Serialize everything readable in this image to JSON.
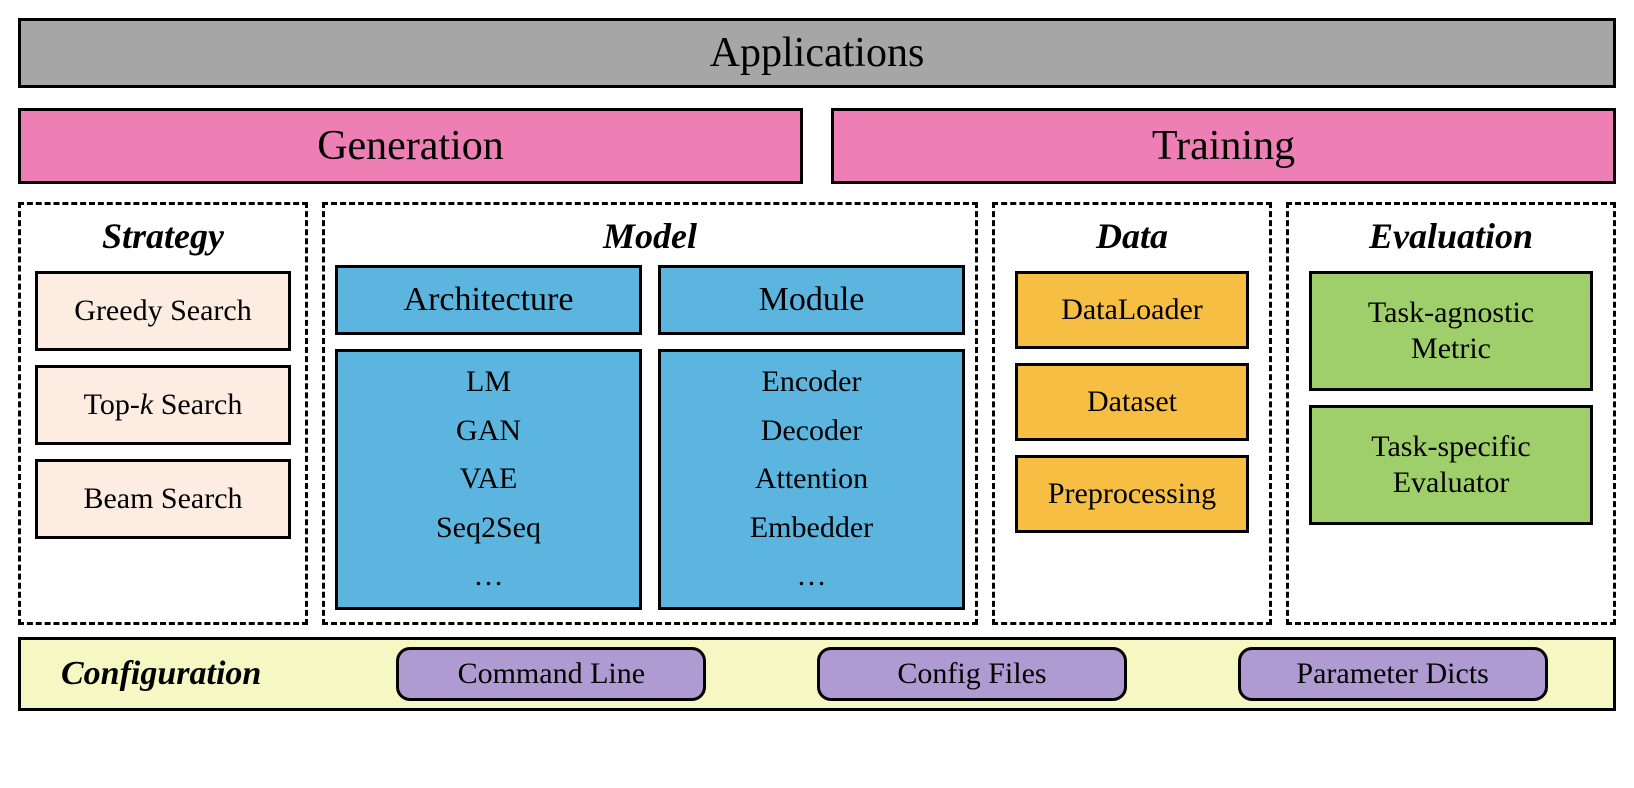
{
  "top": {
    "applications": "Applications"
  },
  "headers": {
    "generation": "Generation",
    "training": "Training"
  },
  "groups": {
    "strategy": {
      "title": "Strategy",
      "items": [
        "Greedy Search",
        "Top-k Search",
        "Beam Search"
      ]
    },
    "model": {
      "title": "Model",
      "architecture": {
        "title": "Architecture",
        "items": [
          "LM",
          "GAN",
          "VAE",
          "Seq2Seq",
          "…"
        ]
      },
      "module": {
        "title": "Module",
        "items": [
          "Encoder",
          "Decoder",
          "Attention",
          "Embedder",
          "…"
        ]
      }
    },
    "data": {
      "title": "Data",
      "items": [
        "DataLoader",
        "Dataset",
        "Preprocessing"
      ]
    },
    "evaluation": {
      "title": "Evaluation",
      "items": [
        {
          "line1": "Task-agnostic",
          "line2": "Metric"
        },
        {
          "line1": "Task-specific",
          "line2": "Evaluator"
        }
      ]
    }
  },
  "config": {
    "title": "Configuration",
    "items": [
      "Command Line",
      "Config Files",
      "Parameter Dicts"
    ]
  }
}
